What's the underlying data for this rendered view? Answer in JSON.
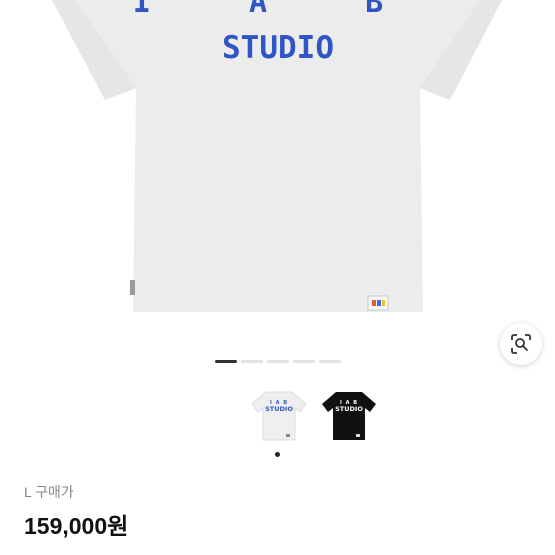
{
  "product": {
    "print_top": "I A B",
    "print_main": "STUDIO",
    "thumb_text": "STUDIO",
    "thumb_top": "I A B"
  },
  "gallery": {
    "page_count": 5,
    "active_page": 1,
    "thumbnails": [
      {
        "color": "white",
        "selected": true
      },
      {
        "color": "black",
        "selected": false
      }
    ]
  },
  "price": {
    "label": "L 구매가",
    "value": "159,000원"
  },
  "colors": {
    "print_blue": "#2f56c4",
    "shirt_white": "#ededed",
    "shirt_black": "#111111"
  },
  "icons": {
    "lens": "image-search-icon"
  }
}
